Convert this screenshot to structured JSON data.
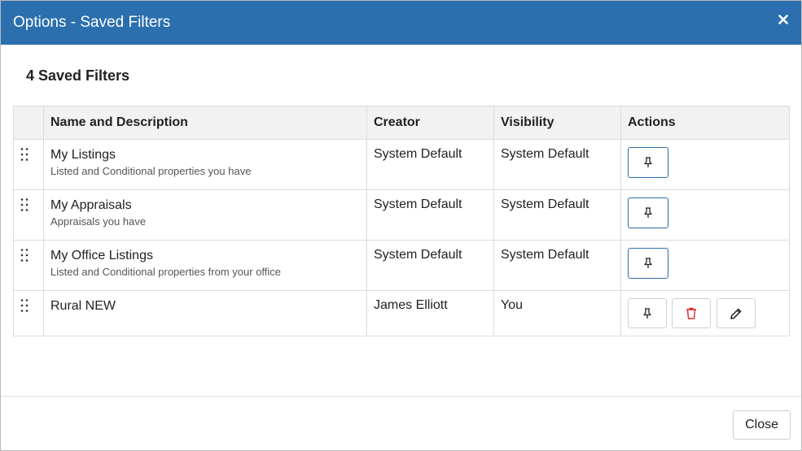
{
  "modal": {
    "title": "Options - Saved Filters",
    "close_icon": "close-icon"
  },
  "heading": "4 Saved Filters",
  "table": {
    "headers": {
      "name": "Name and Description",
      "creator": "Creator",
      "visibility": "Visibility",
      "actions": "Actions"
    },
    "rows": [
      {
        "name": "My Listings",
        "description": "Listed and Conditional properties you have",
        "creator": "System Default",
        "visibility": "System Default",
        "actions": [
          "pin"
        ]
      },
      {
        "name": "My Appraisals",
        "description": "Appraisals you have",
        "creator": "System Default",
        "visibility": "System Default",
        "actions": [
          "pin"
        ]
      },
      {
        "name": "My Office Listings",
        "description": "Listed and Conditional properties from your office",
        "creator": "System Default",
        "visibility": "System Default",
        "actions": [
          "pin"
        ]
      },
      {
        "name": "Rural NEW",
        "description": "",
        "creator": "James Elliott",
        "visibility": "You",
        "actions": [
          "pin",
          "delete",
          "edit"
        ]
      }
    ]
  },
  "icons": {
    "drag": "drag-handle-icon",
    "pin": "pin-icon",
    "delete": "trash-icon",
    "edit": "pencil-icon"
  },
  "colors": {
    "header_bg": "#2b6fae",
    "pinned_border": "#2b6fae",
    "delete_icon": "#e0262b"
  },
  "footer": {
    "close_label": "Close"
  }
}
